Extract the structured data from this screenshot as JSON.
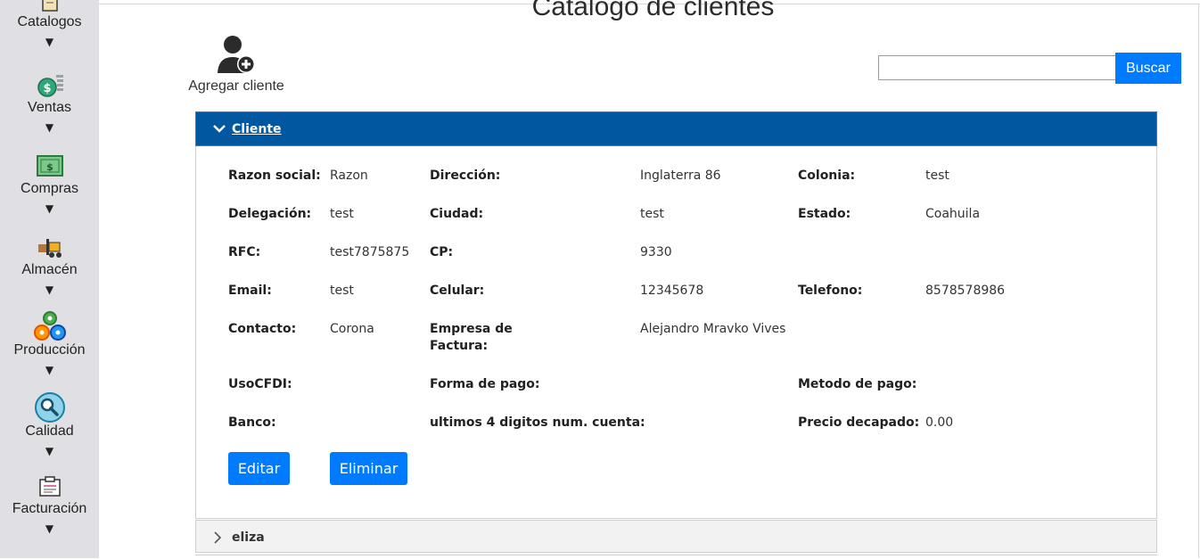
{
  "sidebar": {
    "items": [
      {
        "label": "Catalogos",
        "icon": "catalog-book-icon"
      },
      {
        "label": "Ventas",
        "icon": "coins-dollar-icon"
      },
      {
        "label": "Compras",
        "icon": "cash-bill-icon"
      },
      {
        "label": "Almacén",
        "icon": "forklift-icon"
      },
      {
        "label": "Producción",
        "icon": "gears-production-icon"
      },
      {
        "label": "Calidad",
        "icon": "quality-search-icon"
      },
      {
        "label": "Facturación",
        "icon": "invoice-icon"
      }
    ],
    "caret": "▼"
  },
  "page": {
    "title": "Catalogo de clientes",
    "add_client_label": "Agregar cliente"
  },
  "search": {
    "value": "",
    "placeholder": "",
    "button_label": "Buscar"
  },
  "panel": {
    "header_label": "Cliente",
    "fields": {
      "razon_social": {
        "label": "Razon social:",
        "value": "Razon"
      },
      "direccion": {
        "label": "Dirección:",
        "value": "Inglaterra 86"
      },
      "colonia": {
        "label": "Colonia:",
        "value": "test"
      },
      "delegacion": {
        "label": "Delegación:",
        "value": "test"
      },
      "ciudad": {
        "label": "Ciudad:",
        "value": "test"
      },
      "estado": {
        "label": "Estado:",
        "value": "Coahuila"
      },
      "rfc": {
        "label": "RFC:",
        "value": "test7875875"
      },
      "cp": {
        "label": "CP:",
        "value": "9330"
      },
      "email": {
        "label": "Email:",
        "value": "test"
      },
      "celular": {
        "label": "Celular:",
        "value": "12345678"
      },
      "telefono": {
        "label": "Telefono:",
        "value": "8578578986"
      },
      "contacto": {
        "label": "Contacto:",
        "value": "Corona"
      },
      "empresa_factura": {
        "label_line1": "Empresa de",
        "label_line2": "Factura:",
        "value": "Alejandro Mravko Vives"
      },
      "uso_cfdi": {
        "label": "UsoCFDI:",
        "value": ""
      },
      "forma_pago": {
        "label": "Forma de pago:",
        "value": ""
      },
      "metodo_pago": {
        "label": "Metodo de pago:",
        "value": ""
      },
      "banco": {
        "label": "Banco:",
        "value": ""
      },
      "ultimos_digitos": {
        "label": "ultimos 4 digitos num. cuenta:",
        "value": ""
      },
      "precio_decapado": {
        "label": "Precio decapado:",
        "value": "0.00"
      }
    },
    "edit_label": "Editar",
    "delete_label": "Eliminar"
  },
  "collapsed_panel": {
    "label": "eliza"
  },
  "colors": {
    "primary_button": "#007bff",
    "accordion_header": "#0158a1",
    "sidebar_bg": "#e0e0e4"
  }
}
